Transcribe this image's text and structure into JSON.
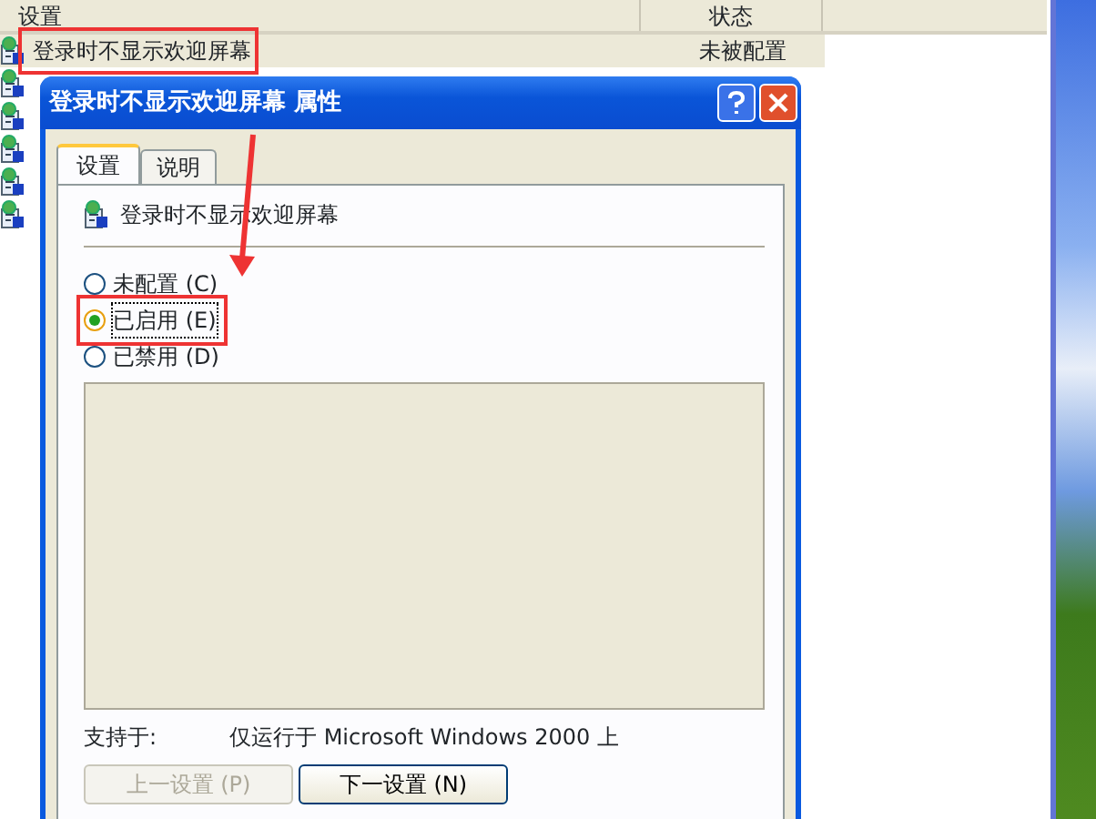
{
  "list": {
    "columns": [
      "设置",
      "状态"
    ],
    "rows": [
      {
        "name": "登录时不显示欢迎屏幕",
        "status": "未被配置",
        "selected": true,
        "annotated": true
      }
    ]
  },
  "dialog": {
    "title": "登录时不显示欢迎屏幕 属性",
    "tabs": [
      {
        "label": "设置",
        "selected": true
      },
      {
        "label": "说明",
        "selected": false
      }
    ],
    "policy_name": "登录时不显示欢迎屏幕",
    "options": [
      {
        "label": "未配置 (C)",
        "selected": false,
        "annotated": false
      },
      {
        "label": "已启用 (E)",
        "selected": true,
        "annotated": true
      },
      {
        "label": "已禁用 (D)",
        "selected": false,
        "annotated": false
      }
    ],
    "supported_label": "支持于:",
    "supported_value": "仅运行于 Microsoft Windows 2000 上",
    "buttons": [
      {
        "label": "上一设置 (P)",
        "disabled": true
      },
      {
        "label": "下一设置 (N)",
        "disabled": false
      }
    ]
  }
}
